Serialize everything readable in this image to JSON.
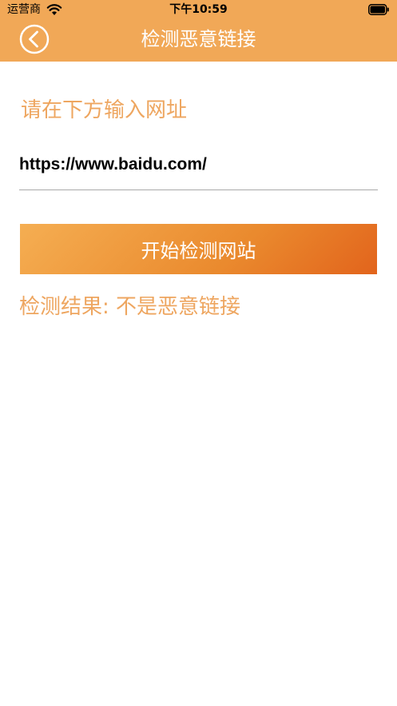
{
  "status_bar": {
    "carrier": "运营商",
    "time": "下午10:59"
  },
  "nav": {
    "title": "检测恶意链接"
  },
  "form": {
    "prompt": "请在下方输入网址",
    "url_value": "https://www.baidu.com/",
    "start_button_label": "开始检测网站"
  },
  "result": {
    "text": "检测结果: 不是恶意链接"
  },
  "colors": {
    "navbar_bg": "#f1a857",
    "accent_text": "#eea660",
    "button_gradient_start": "#f5ae52",
    "button_gradient_end": "#e2641c"
  },
  "icons": {
    "back": "back-chevron-circle-icon",
    "wifi": "wifi-icon",
    "battery": "battery-icon"
  }
}
